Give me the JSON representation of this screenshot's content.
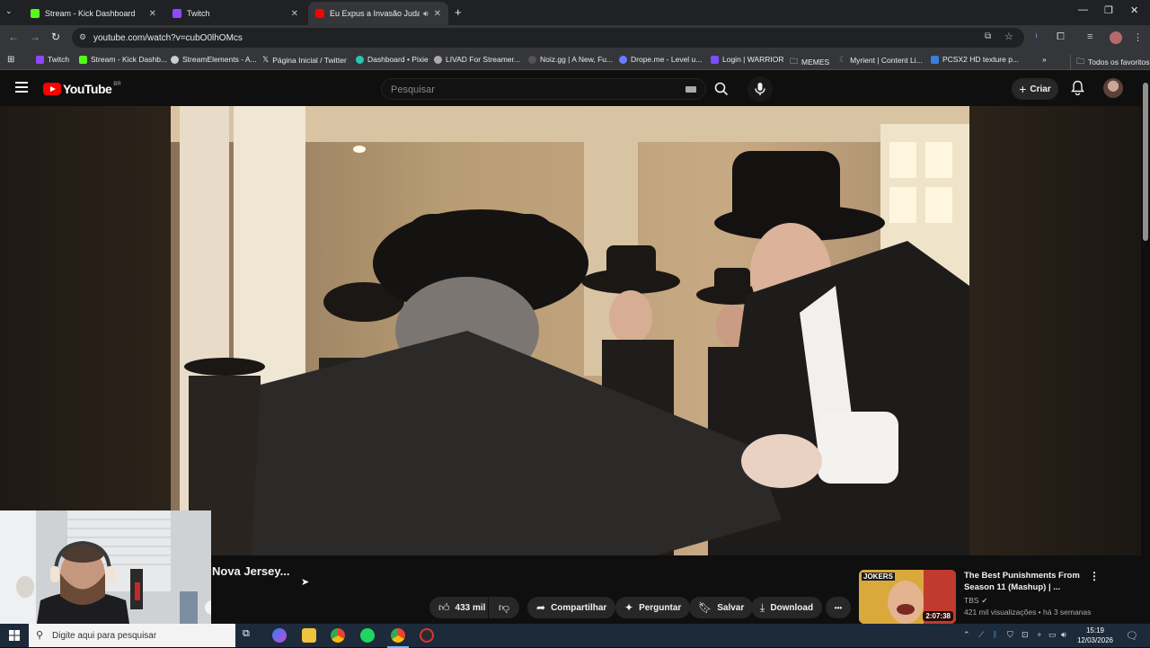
{
  "browser": {
    "tabs": [
      {
        "title": "Stream - Kick Dashboard",
        "close": "✕",
        "favicon_color": "#53fc18"
      },
      {
        "title": "Twitch",
        "close": "✕",
        "favicon_color": "#9146ff"
      },
      {
        "title": "Eu Expus a Invasão Judaica",
        "close": "✕",
        "favicon_color": "#ff0000"
      }
    ],
    "new_tab": "+",
    "url": "youtube.com/watch?v=cubO0lhOMcs",
    "bookmarks": [
      {
        "label": "Twitch",
        "color": "#9146ff"
      },
      {
        "label": "Stream - Kick Dashb...",
        "color": "#53fc18"
      },
      {
        "label": "StreamElements - A...",
        "color": "#cccccc"
      },
      {
        "label": "Página Inicial / Twitter",
        "color": "#000000"
      },
      {
        "label": "Dashboard • Pixie",
        "color": "#2cc4b4"
      },
      {
        "label": "LIVAD For Streamer...",
        "color": "#aaaaaa"
      },
      {
        "label": "Noiz.gg | A New, Fu...",
        "color": "#555555"
      },
      {
        "label": "Drope.me - Level u...",
        "color": "#6a7cff"
      },
      {
        "label": "Login | WARRIOR",
        "color": "#7b4dff"
      },
      {
        "label": "MEMES",
        "color": "#9aa0a6"
      },
      {
        "label": "Myrient | Content Li...",
        "color": "#888888"
      },
      {
        "label": "PCSX2 HD texture p...",
        "color": "#3b7dd8"
      }
    ],
    "bookmarks_more": "»",
    "all_bookmarks": "Todos os favoritos"
  },
  "youtube": {
    "logo_text": "YouTube",
    "country_code": "BR",
    "search_placeholder": "Pesquisar",
    "create_label": "Criar",
    "video_title": "Nova Jersey...",
    "actions": {
      "like_count": "433 mil",
      "share": "Compartilhar",
      "ask": "Perguntar",
      "save": "Salvar",
      "download": "Download",
      "more": "•••"
    },
    "suggestion": {
      "title": "The Best Punishments From Season 11 (Mashup) | ...",
      "channel": "TBS",
      "meta": "421 mil visualizações • há 3 semanas",
      "duration": "2:07:38",
      "thumb_label": "JOKERS"
    }
  },
  "taskbar": {
    "search_placeholder": "Digite aqui para pesquisar",
    "time": "15:19",
    "date": "12/03/2026"
  }
}
